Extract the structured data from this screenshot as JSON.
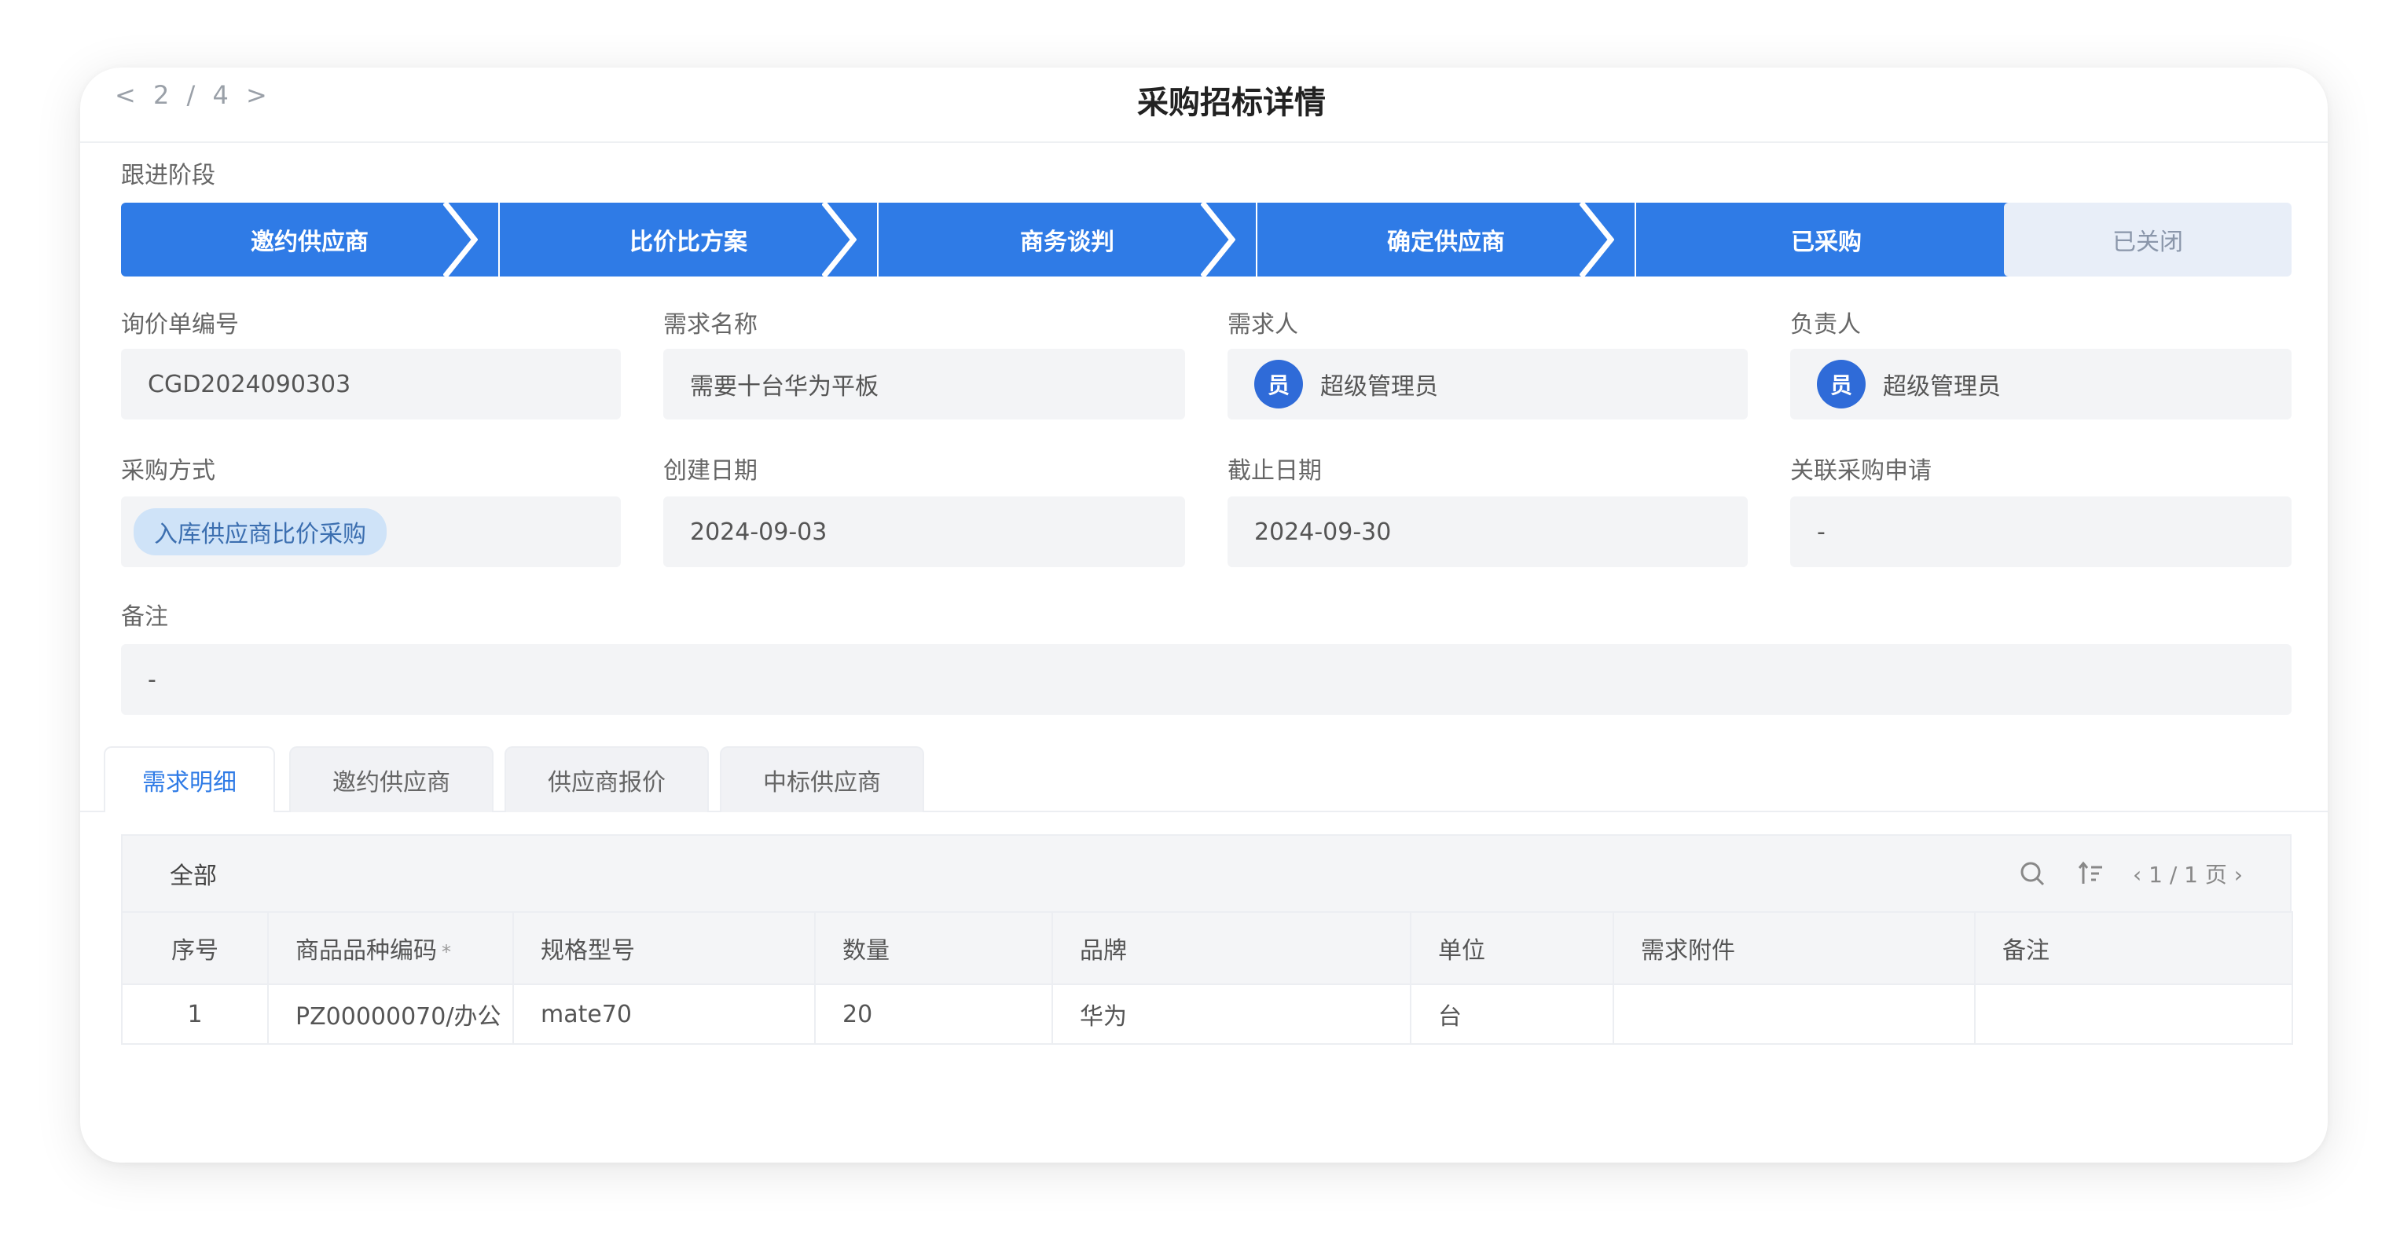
{
  "window": {
    "pager": "< 2 / 4 >",
    "title": "采购招标详情"
  },
  "stage_section": {
    "label": "跟进阶段",
    "stages": [
      "邀约供应商",
      "比价比方案",
      "商务谈判",
      "确定供应商",
      "已采购"
    ],
    "closed": "已关闭"
  },
  "fields": {
    "inquiry_no": {
      "label": "询价单编号",
      "value": "CGD2024090303"
    },
    "req_name": {
      "label": "需求名称",
      "value": "需要十台华为平板"
    },
    "requester": {
      "label": "需求人",
      "avatar": "员",
      "value": "超级管理员"
    },
    "owner": {
      "label": "负责人",
      "avatar": "员",
      "value": "超级管理员"
    },
    "method": {
      "label": "采购方式",
      "value": "入库供应商比价采购"
    },
    "created": {
      "label": "创建日期",
      "value": "2024-09-03"
    },
    "deadline": {
      "label": "截止日期",
      "value": "2024-09-30"
    },
    "related": {
      "label": "关联采购申请",
      "value": "-"
    },
    "remark": {
      "label": "备注",
      "value": "-"
    }
  },
  "tabs": [
    "需求明细",
    "邀约供应商",
    "供应商报价",
    "中标供应商"
  ],
  "table": {
    "filter": "全部",
    "pagination": "‹ 1 / 1 页 ›",
    "columns": [
      "序号",
      "商品品种编码",
      "规格型号",
      "数量",
      "品牌",
      "单位",
      "需求附件",
      "备注"
    ],
    "required_mark": "*",
    "rows": [
      [
        "1",
        "PZ00000070/办公",
        "mate70",
        "20",
        "华为",
        "台",
        "",
        ""
      ]
    ]
  },
  "colors": {
    "accent": "#2f7be6",
    "closed_bg": "#e8eef8",
    "field_bg": "#f3f4f6"
  }
}
